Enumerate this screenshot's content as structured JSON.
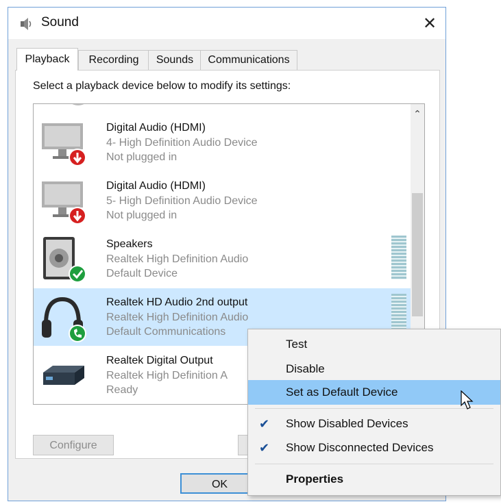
{
  "window": {
    "title": "Sound",
    "close_glyph": "✕"
  },
  "tabs": [
    {
      "label": "Playback",
      "active": true
    },
    {
      "label": "Recording"
    },
    {
      "label": "Sounds"
    },
    {
      "label": "Communications"
    }
  ],
  "instruction": "Select a playback device below to modify its settings:",
  "devices": [
    {
      "name": "Digital Audio (HDMI)",
      "driver": "4- High Definition Audio Device",
      "status": "Not plugged in",
      "icon": "monitor-unplugged-icon"
    },
    {
      "name": "Digital Audio (HDMI)",
      "driver": "5- High Definition Audio Device",
      "status": "Not plugged in",
      "icon": "monitor-unplugged-icon"
    },
    {
      "name": "Speakers",
      "driver": "Realtek High Definition Audio",
      "status": "Default Device",
      "icon": "speaker-default-icon"
    },
    {
      "name": "Realtek HD Audio 2nd output",
      "driver": "Realtek High Definition Audio",
      "status": "Default Communications",
      "icon": "headphones-comm-icon",
      "selected": true
    },
    {
      "name": "Realtek Digital Output",
      "driver": "Realtek High Definition A",
      "status": "Ready",
      "icon": "digital-output-icon"
    }
  ],
  "buttons": {
    "configure": "Configure",
    "ok": "OK"
  },
  "context_menu": {
    "items": [
      {
        "label": "Test"
      },
      {
        "label": "Disable"
      },
      {
        "label": "Set as Default Device",
        "hover": true
      },
      {
        "label": "Show Disabled Devices",
        "checked": true
      },
      {
        "label": "Show Disconnected Devices",
        "checked": true
      },
      {
        "label": "Properties",
        "bold": true
      }
    ],
    "check_glyph": "✔"
  },
  "colors": {
    "selection": "#cde8ff",
    "menu_hover": "#91c9f7",
    "default_badge": "#1e9e3e",
    "unplugged_badge": "#d62020"
  }
}
